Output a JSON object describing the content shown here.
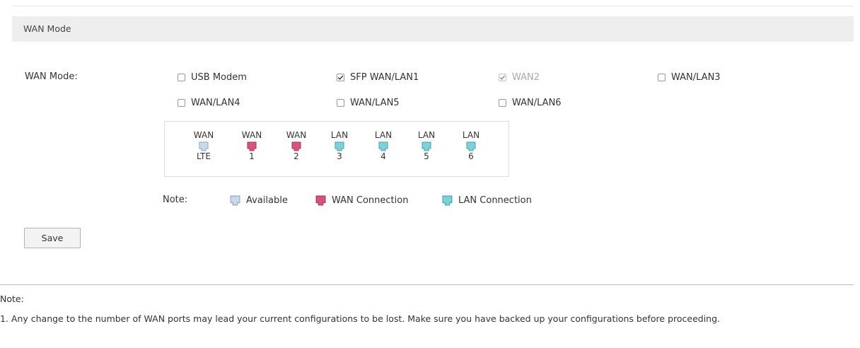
{
  "panel": {
    "title": "WAN Mode"
  },
  "form": {
    "label": "WAN Mode:",
    "options": [
      {
        "label": "USB Modem",
        "checked": false,
        "disabled": false
      },
      {
        "label": "SFP WAN/LAN1",
        "checked": true,
        "disabled": false
      },
      {
        "label": "WAN2",
        "checked": true,
        "disabled": true
      },
      {
        "label": "WAN/LAN3",
        "checked": false,
        "disabled": false
      },
      {
        "label": "WAN/LAN4",
        "checked": false,
        "disabled": false
      },
      {
        "label": "WAN/LAN5",
        "checked": false,
        "disabled": false
      },
      {
        "label": "WAN/LAN6",
        "checked": false,
        "disabled": false
      }
    ]
  },
  "ports": [
    {
      "type": "WAN",
      "num": "LTE",
      "state": "available"
    },
    {
      "type": "WAN",
      "num": "1",
      "state": "wan"
    },
    {
      "type": "WAN",
      "num": "2",
      "state": "wan"
    },
    {
      "type": "LAN",
      "num": "3",
      "state": "lan"
    },
    {
      "type": "LAN",
      "num": "4",
      "state": "lan"
    },
    {
      "type": "LAN",
      "num": "5",
      "state": "lan"
    },
    {
      "type": "LAN",
      "num": "6",
      "state": "lan"
    }
  ],
  "legend": {
    "note_label": "Note:",
    "available": "Available",
    "wan": "WAN Connection",
    "lan": "LAN Connection"
  },
  "colors": {
    "available": "#c9d8ea",
    "wan": "#d9547c",
    "lan": "#7fd1d9"
  },
  "save_label": "Save",
  "note": {
    "title": "Note:",
    "line1": "1. Any change to the number of WAN ports may lead your current configurations to be lost. Make sure you have backed up your configurations before proceeding."
  }
}
